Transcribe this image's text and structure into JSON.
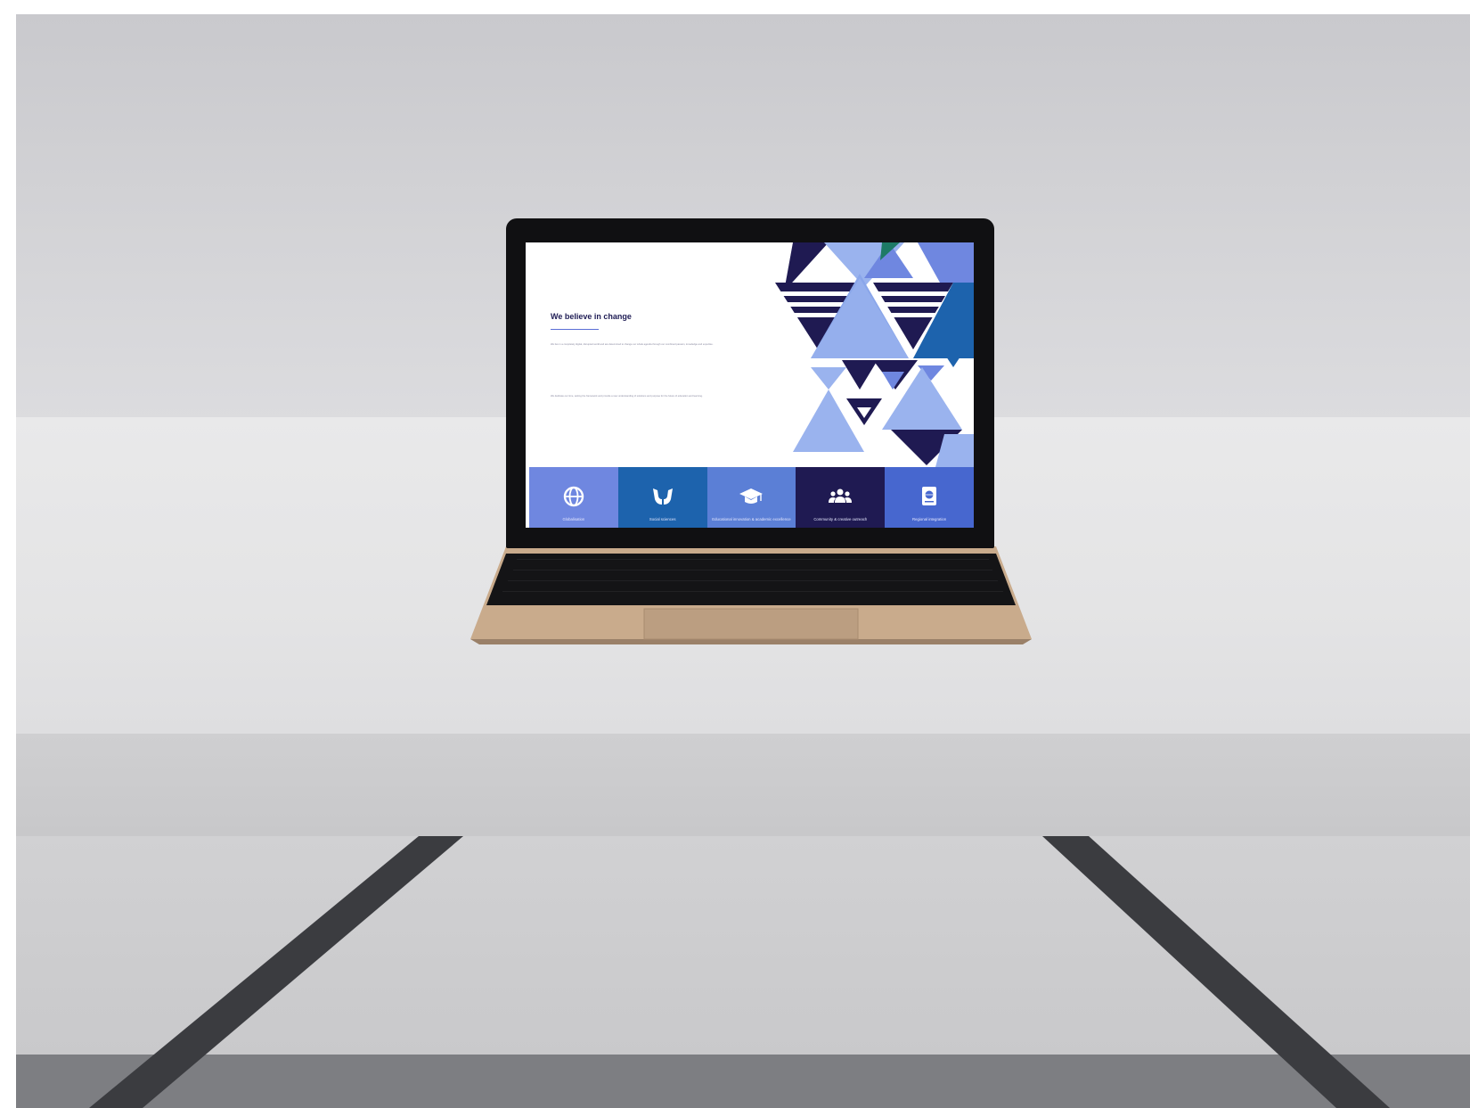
{
  "screen": {
    "heading": "We believe in change",
    "paragraphs": [
      "We live in a completely digital, disrupted world and are determined to change our whole agenda through our combined passion, knowledge and expertise.",
      "We dedicate our time, setting the framework and provide a new understanding of solutions and purpose for the future of education and learning."
    ],
    "tiles": [
      {
        "label": "Globalisation",
        "icon": "globe-icon",
        "color": "#6f87e0"
      },
      {
        "label": "Social sciences",
        "icon": "hands-icon",
        "color": "#1d63ad"
      },
      {
        "label": "Educational innovation & academic excellence",
        "icon": "graduation-cap-icon",
        "color": "#5b7fd6"
      },
      {
        "label": "Community & creative outreach",
        "icon": "people-icon",
        "color": "#1f1a52"
      },
      {
        "label": "Regional integration",
        "icon": "book-globe-icon",
        "color": "#4767cf"
      }
    ]
  },
  "colors": {
    "navy": "#1f1a52",
    "blue": "#1d63ad",
    "periwinkle": "#6f87e0",
    "light_periwinkle": "#9ab3ee",
    "wall": "#d2d2d5",
    "table": "#e6e6e8",
    "laptop_gold": "#c8a98a"
  }
}
